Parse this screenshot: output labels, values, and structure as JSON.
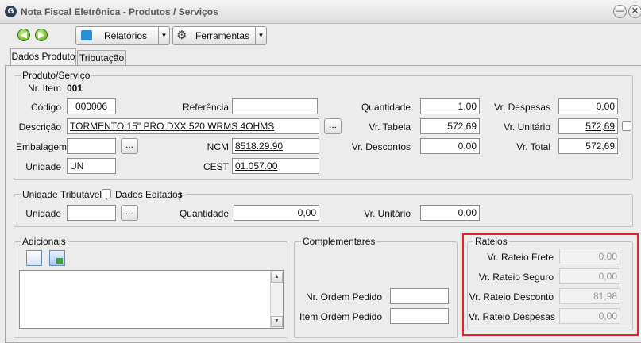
{
  "window": {
    "title": "Nota Fiscal Eletrônica - Produtos / Serviços"
  },
  "toolbar": {
    "relatorios_label": "Relatórios",
    "ferramentas_label": "Ferramentas"
  },
  "tabs": [
    {
      "label": "Dados Produto"
    },
    {
      "label": "Tributação"
    }
  ],
  "produto": {
    "legend": "Produto/Serviço",
    "nr_item_label": "Nr. Item",
    "nr_item_value": "001",
    "codigo_label": "Código",
    "codigo_value": "000006",
    "referencia_label": "Referência",
    "referencia_value": "",
    "quantidade_label": "Quantidade",
    "quantidade_value": "1,00",
    "vr_despesas_label": "Vr. Despesas",
    "vr_despesas_value": "0,00",
    "descricao_label": "Descrição",
    "descricao_value": "TORMENTO 15\" PRO DXX 520 WRMS 4OHMS",
    "vr_tabela_label": "Vr. Tabela",
    "vr_tabela_value": "572,69",
    "vr_unitario_label": "Vr. Unitário",
    "vr_unitario_value": "572,69",
    "embalagem_label": "Embalagem",
    "embalagem_value": "",
    "ncm_label": "NCM",
    "ncm_value": "8518.29.90",
    "vr_descontos_label": "Vr. Descontos",
    "vr_descontos_value": "0,00",
    "vr_total_label": "Vr. Total",
    "vr_total_value": "572,69",
    "unidade_label": "Unidade",
    "unidade_value": "UN",
    "cest_label": "CEST",
    "cest_value": "01.057.00",
    "dots_label": "..."
  },
  "unidade_trib": {
    "legend_prefix": "Unidade Tributável (",
    "legend_check_label": "Dados Editados",
    "legend_suffix": ")",
    "unidade_label": "Unidade",
    "unidade_value": "",
    "quantidade_label": "Quantidade",
    "quantidade_value": "0,00",
    "vr_unitario_label": "Vr. Unitário",
    "vr_unitario_value": "0,00",
    "dots_label": "..."
  },
  "adicionais": {
    "legend": "Adicionais"
  },
  "complementares": {
    "legend": "Complementares",
    "nr_ordem_label": "Nr. Ordem Pedido",
    "nr_ordem_value": "",
    "item_ordem_label": "Item Ordem Pedido",
    "item_ordem_value": ""
  },
  "rateios": {
    "legend": "Rateios",
    "frete_label": "Vr. Rateio Frete",
    "frete_value": "0,00",
    "seguro_label": "Vr. Rateio Seguro",
    "seguro_value": "0,00",
    "desconto_label": "Vr. Rateio Desconto",
    "desconto_value": "81,98",
    "despesas_label": "Vr. Rateio Despesas",
    "despesas_value": "0,00"
  },
  "colors": {
    "highlight": "#e0242b",
    "nav_green": "#4ea31b",
    "app_icon": "#2f3e57"
  }
}
